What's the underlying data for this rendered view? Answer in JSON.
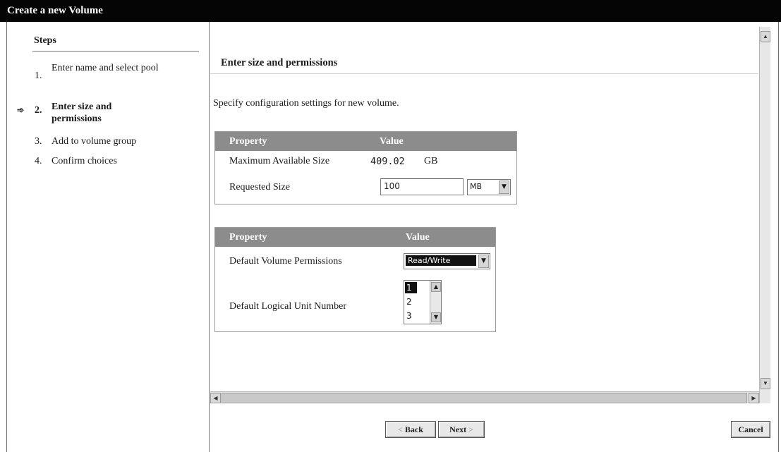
{
  "window": {
    "title": "Create a new Volume"
  },
  "steps": {
    "heading": "Steps",
    "items": [
      {
        "number": "1.",
        "label": "Enter name and select pool"
      },
      {
        "number": "2.",
        "label": "Enter size and permissions"
      },
      {
        "number": "3.",
        "label": "Add to volume group"
      },
      {
        "number": "4.",
        "label": "Confirm choices"
      }
    ],
    "current_index": 1
  },
  "main": {
    "section_title": "Enter size and permissions",
    "description": "Specify configuration settings for new volume.",
    "size_table": {
      "headers": {
        "property": "Property",
        "value": "Value"
      },
      "max_size_label": "Maximum Available Size",
      "max_size_value": "409.02",
      "max_size_unit": "GB",
      "requested_label": "Requested Size",
      "requested_value": "100",
      "requested_unit": "MB"
    },
    "perm_table": {
      "headers": {
        "property": "Property",
        "value": "Value"
      },
      "permissions_label": "Default Volume Permissions",
      "permissions_value": "Read/Write",
      "lun_label": "Default Logical Unit Number",
      "lun_options": [
        "1",
        "2",
        "3"
      ],
      "lun_selected": "1"
    }
  },
  "footer": {
    "back_label": "Back",
    "next_label": "Next",
    "cancel_label": "Cancel"
  },
  "colors": {
    "titlebar": "#050505",
    "table_header": "#8c8c8c"
  }
}
